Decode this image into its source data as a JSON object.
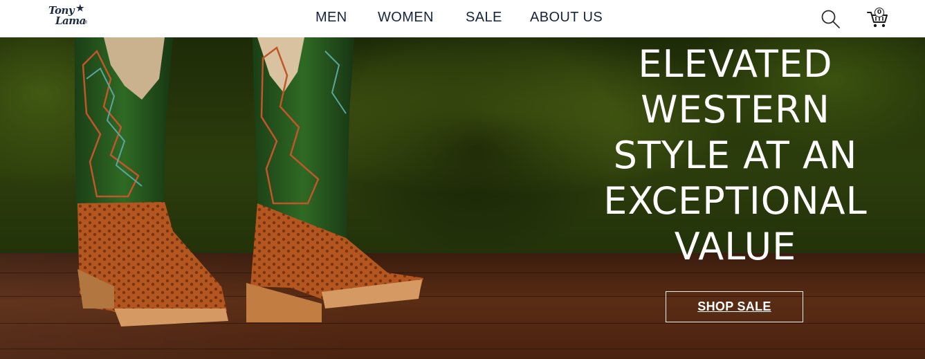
{
  "header": {
    "logo": {
      "line1": "Tony",
      "line2": "Lama",
      "star": "★",
      "registered": "®"
    },
    "nav": [
      {
        "label": "MEN"
      },
      {
        "label": "WOMEN"
      },
      {
        "label": "SALE"
      },
      {
        "label": "ABOUT US"
      }
    ],
    "search_icon": "search-icon",
    "cart": {
      "icon": "cart-icon",
      "count": "0"
    }
  },
  "hero": {
    "headline": "ELEVATED\nWESTERN\nSTYLE AT AN\nEXCEPTIONAL\nVALUE",
    "cta_label": "SHOP SALE",
    "image": "green-and-ostrich-western-boots"
  },
  "colors": {
    "nav_text": "#16233d",
    "hero_text": "#ffffff",
    "backdrop_green": "#2c3d0c",
    "floor_brown": "#5a2c14",
    "boot_shaft_green": "#27581f",
    "boot_ostrich": "#b0521f"
  }
}
